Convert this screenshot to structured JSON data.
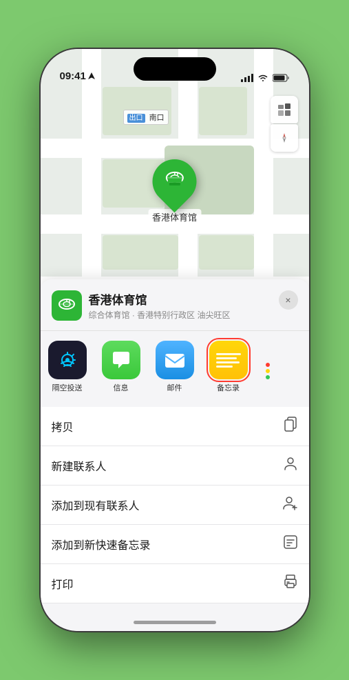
{
  "status_bar": {
    "time": "09:41",
    "location_arrow": "▶"
  },
  "map": {
    "label_south_gate": "南口",
    "location_name": "香港体育馆",
    "controls": {
      "map_type": "🗺",
      "compass": "➤"
    }
  },
  "venue": {
    "name": "香港体育馆",
    "subtitle": "综合体育馆 · 香港特别行政区 油尖旺区",
    "close_label": "×"
  },
  "app_icons": [
    {
      "id": "airdrop",
      "label": "隔空投送",
      "type": "airdrop"
    },
    {
      "id": "messages",
      "label": "信息",
      "type": "messages"
    },
    {
      "id": "mail",
      "label": "邮件",
      "type": "mail"
    },
    {
      "id": "notes",
      "label": "备忘录",
      "type": "notes",
      "selected": true
    }
  ],
  "more_dots": {
    "colors": [
      "#ff3b30",
      "#ffd60a",
      "#34c759"
    ]
  },
  "menu_items": [
    {
      "id": "copy",
      "label": "拷贝",
      "icon": "copy"
    },
    {
      "id": "new-contact",
      "label": "新建联系人",
      "icon": "person"
    },
    {
      "id": "add-existing",
      "label": "添加到现有联系人",
      "icon": "person-add"
    },
    {
      "id": "quick-note",
      "label": "添加到新快速备忘录",
      "icon": "note"
    },
    {
      "id": "print",
      "label": "打印",
      "icon": "printer"
    }
  ]
}
